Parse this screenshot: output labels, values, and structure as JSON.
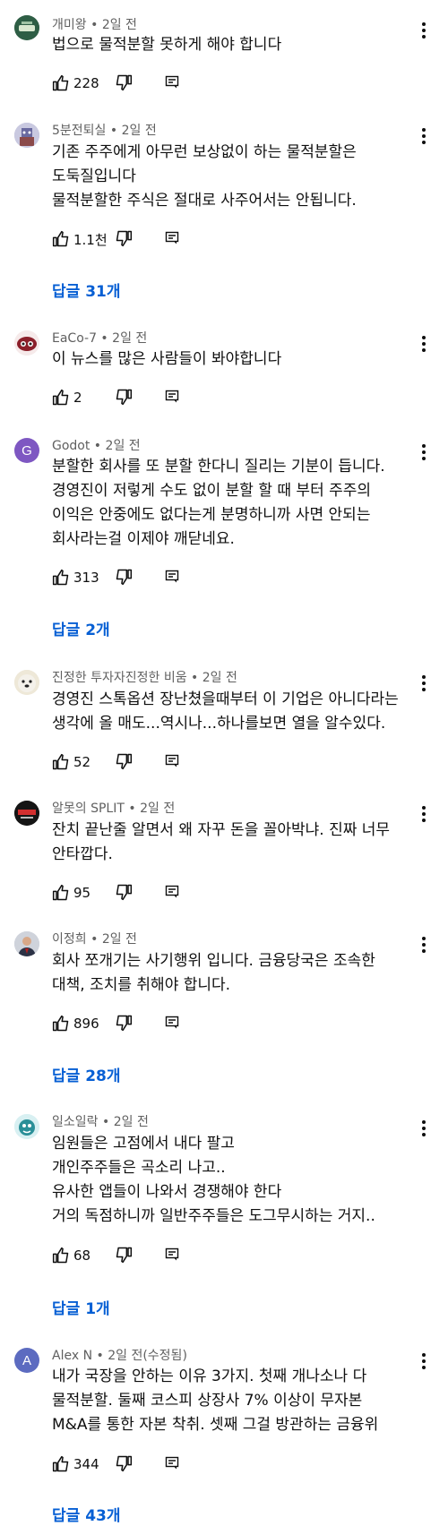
{
  "comments": [
    {
      "author": "개미왕",
      "time": "2일 전",
      "lines": [
        "법으로 물적분할 못하게 해야 합니다"
      ],
      "likes": "228",
      "replies": ""
    },
    {
      "author": "5분전퇴실",
      "time": "2일 전",
      "lines": [
        "기존 주주에게 아무런 보상없이 하는 물적분할은",
        "도둑질입니다",
        "물적분할한 주식은 절대로 사주어서는 안됩니다."
      ],
      "likes": "1.1천",
      "replies": "답글 31개"
    },
    {
      "author": "EaCo-7",
      "time": "2일 전",
      "lines": [
        "이 뉴스를 많은 사람들이 봐야합니다"
      ],
      "likes": "2",
      "replies": ""
    },
    {
      "author": "Godot",
      "time": "2일 전",
      "lines": [
        "분할한 회사를 또 분할 한다니 질리는 기분이 듭니다.",
        "경영진이 저렇게 수도 없이 분할 할 때 부터 주주의",
        "이익은 안중에도 없다는게 분명하니까 사면 안되는",
        "회사라는걸 이제야 깨닫네요."
      ],
      "likes": "313",
      "replies": "답글 2개",
      "avatar_letter": "G",
      "avatar_color": "#7e57c2"
    },
    {
      "author": "진정한 투자자진정한 비움",
      "time": "2일 전",
      "lines": [
        "경영진 스톡옵션 장난쳤을때부터 이 기업은 아니다라는",
        "생각에 올 매도...역시나...하나를보면 열을 알수있다."
      ],
      "likes": "52",
      "replies": ""
    },
    {
      "author": "알못의 SPLIT",
      "time": "2일 전",
      "lines": [
        "잔치 끝난줄 알면서 왜 자꾸 돈을 꼴아박냐. 진짜 너무",
        "안타깝다."
      ],
      "likes": "95",
      "replies": ""
    },
    {
      "author": "이정희",
      "time": "2일 전",
      "lines": [
        "회사 쪼개기는 사기행위 입니다. 금융당국은 조속한",
        "대책, 조치를 취해야 합니다."
      ],
      "likes": "896",
      "replies": "답글 28개"
    },
    {
      "author": "일소일락",
      "time": "2일 전",
      "lines": [
        "임원들은 고점에서 내다 팔고",
        "개인주주들은 곡소리 나고..",
        "유사한 앱들이 나와서 경쟁해야 한다",
        "거의 독점하니까 일반주주들은 도그무시하는 거지.."
      ],
      "likes": "68",
      "replies": "답글 1개"
    },
    {
      "author": "Alex N",
      "time": "2일 전(수정됨)",
      "lines": [
        "내가 국장을 안하는 이유 3가지. 첫째 개나소나 다",
        "물적분할. 둘째 코스피 상장사 7% 이상이 무자본",
        "M&A를 통한 자본 착취. 셋째 그걸 방관하는 금융위"
      ],
      "likes": "344",
      "replies": "답글 43개",
      "avatar_letter": "A",
      "avatar_color": "#5c6bc0"
    }
  ],
  "icons": {
    "like": "thumb-up-icon",
    "dislike": "thumb-down-icon",
    "reply": "reply-icon",
    "more": "more-vert-icon"
  },
  "colors": {
    "link": "#065fd4",
    "meta": "#606060"
  }
}
